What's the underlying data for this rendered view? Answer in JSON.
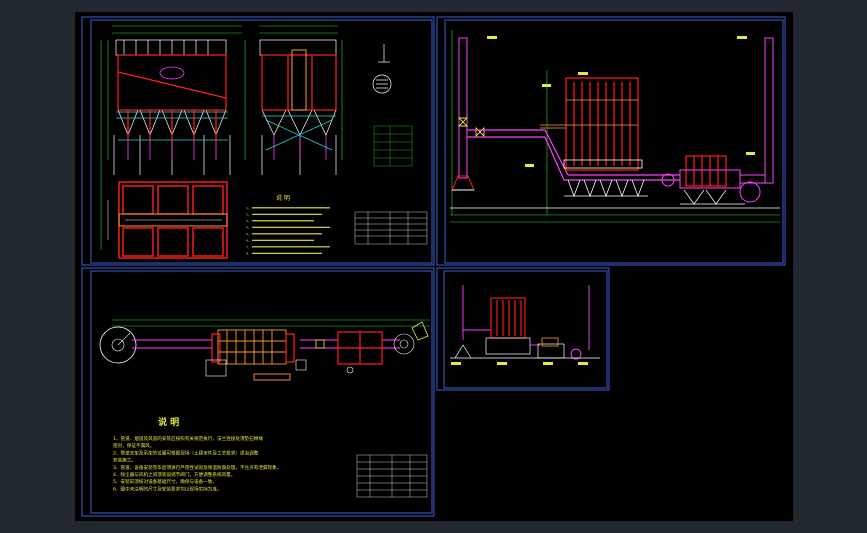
{
  "viewer": {
    "background": "#212830",
    "canvas_color": "#000000"
  },
  "drawing": {
    "frame_color": "#3a5fd0",
    "colors": {
      "outline": "#ff2020",
      "structure": "#ffffff",
      "dimension": "#22dd22",
      "note": "#e8e840",
      "accent": "#ff40ff",
      "pipe": "#ffa020",
      "cyan": "#20e0e0"
    },
    "sheet1": {
      "note_title": "说 明",
      "note_lines": [
        "1、",
        "2、",
        "3、",
        "4、",
        "5、",
        "6、",
        "7、",
        "8、"
      ]
    },
    "sheet3": {
      "note_title": "说 明",
      "note_lines": [
        "1、管道、烟道及风道的安装应按照有关规范执行，法兰连接处须垫石棉绳",
        "   密封，保证不漏风。",
        "2、管道支架及吊架的位置可根据现场（土建条件及工艺要求）适当调整",
        "   安装施工。",
        "3、管道、设备安装完毕后须进行严密性试验及保温防腐处理，不允许有泄漏现象。",
        "4、除尘器与风机之间须装设调节阀门，方便调整系统风量。",
        "5、安装前须核对设备基础尺寸，确保与设备一致。",
        "6、图中未注明的尺寸及安装要求均以现场实际为准。"
      ]
    }
  }
}
